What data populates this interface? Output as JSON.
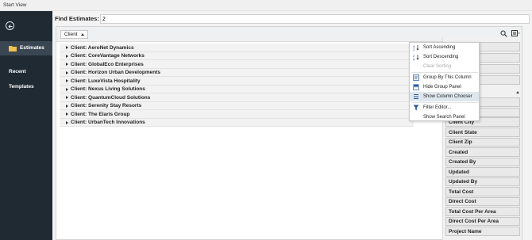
{
  "window": {
    "title": "Start View"
  },
  "sidebar": {
    "items": [
      {
        "label": "Estimates",
        "active": true
      },
      {
        "label": "Recent"
      },
      {
        "label": "Templates"
      }
    ]
  },
  "find": {
    "label": "Find Estimates:",
    "value": "2"
  },
  "grid": {
    "group_chip": "Client",
    "rows": [
      "Client: AeroNet Dynamics",
      "Client: CoreVantage Networks",
      "Client: GlobalEco Enterprises",
      "Client: Horizon Urban Developments",
      "Client: LuxeVista Hospitality",
      "Client: Nexus Living Solutions",
      "Client: QuantumCloud Solutions",
      "Client: Serenity Stay Resorts",
      "Client: The Elaris Group",
      "Client: UrbanTech Innovations"
    ]
  },
  "context_menu": {
    "items": [
      {
        "label": "Sort Ascending",
        "icon": "sort-ascending-icon"
      },
      {
        "label": "Sort Descending",
        "icon": "sort-descending-icon"
      },
      {
        "label": "Clear Sorting",
        "disabled": true
      },
      {
        "label": "Group By This Column",
        "icon": "group-by-icon"
      },
      {
        "label": "Hide Group Panel",
        "icon": "group-panel-icon"
      },
      {
        "label": "Show Column Chooser",
        "icon": "column-chooser-icon",
        "highlighted": true
      },
      {
        "label": "Filter Editor...",
        "icon": "filter-icon"
      },
      {
        "label": "Show Search Panel"
      }
    ]
  },
  "column_chooser": {
    "visible_partial": [
      "Client City"
    ],
    "items": [
      "Client State",
      "Client Zip",
      "Created",
      "Created By",
      "Updated",
      "Updated By",
      "Total Cost",
      "Direct Cost",
      "Total Cost Per Area",
      "Direct Cost Per Area",
      "Project Name"
    ]
  },
  "colors": {
    "sidebar_bg": "#1f2a33",
    "sidebar_active": "#3a4752",
    "menu_highlight": "#dfe7ee",
    "accent_blue": "#2b5797"
  }
}
